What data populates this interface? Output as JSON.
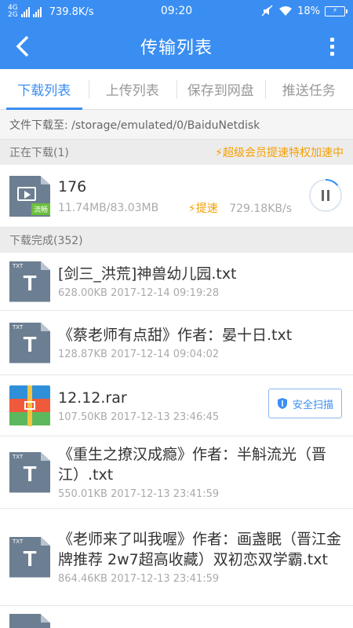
{
  "status_bar": {
    "network_top": "4G",
    "network_bottom": "2G",
    "speed": "739.8K/s",
    "time": "09:20",
    "battery": "18%"
  },
  "app_bar": {
    "title": "传输列表"
  },
  "tabs": [
    {
      "label": "下载列表",
      "active": true
    },
    {
      "label": "上传列表",
      "active": false
    },
    {
      "label": "保存到网盘",
      "active": false
    },
    {
      "label": "推送任务",
      "active": false
    }
  ],
  "download_path": "文件下载至: /storage/emulated/0/BaiduNetdisk",
  "downloading": {
    "header": "正在下载(1)",
    "promo": "⚡超级会员提速特权加速中",
    "item": {
      "name": "176",
      "icon_flag": "流畅",
      "progress_text": "11.74MB/83.03MB",
      "progress_fraction": 0.14,
      "boost": "⚡提速",
      "speed": "729.18KB/s"
    }
  },
  "completed": {
    "header": "下载完成(352)",
    "items": [
      {
        "name": "[剑三_洪荒]神兽幼儿园.txt",
        "meta": "628.00KB 2017-12-14 09:19:28",
        "type": "txt"
      },
      {
        "name": "《蔡老师有点甜》作者：晏十日.txt",
        "meta": "128.87KB 2017-12-14 09:04:02",
        "type": "txt"
      },
      {
        "name": "12.12.rar",
        "meta": "107.50KB 2017-12-13 23:46:45",
        "type": "rar",
        "action": "安全扫描"
      },
      {
        "name": "《重生之撩汉成瘾》作者：半斛流光（晋江）.txt",
        "meta": "550.01KB 2017-12-13 23:41:59",
        "type": "txt"
      },
      {
        "name": "《老师来了叫我喔》作者：画盏眠（晋江金牌推荐 2w7超高收藏）双初恋双学霸.txt",
        "meta": "864.46KB 2017-12-13 23:41:59",
        "type": "txt"
      }
    ]
  },
  "txt_icon_label": "TXT",
  "txt_icon_letter": "T",
  "colors": {
    "accent": "#3a8ef2",
    "promo": "#f5a000"
  }
}
